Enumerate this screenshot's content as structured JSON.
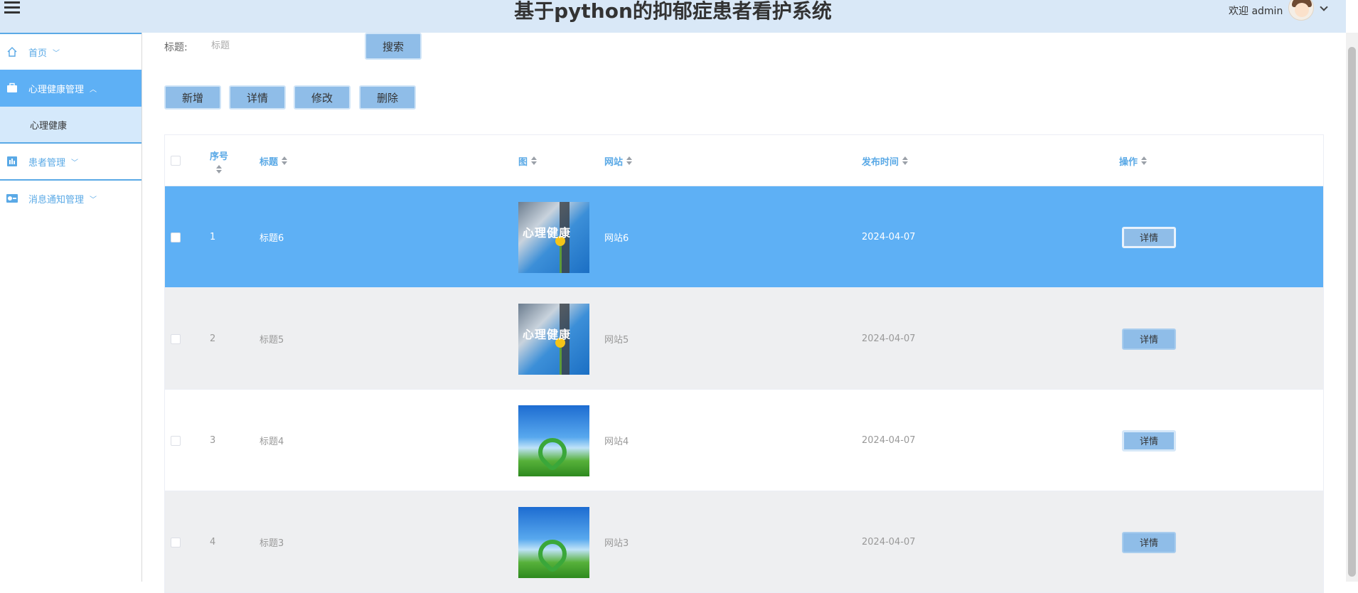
{
  "header": {
    "title": "基于python的抑郁症患者看护系统",
    "welcome": "欢迎 admin"
  },
  "sidebar": {
    "items": [
      {
        "label": "首页",
        "icon": "home-icon",
        "chevron": "﹀"
      },
      {
        "label": "心理健康管理",
        "icon": "briefcase-icon",
        "chevron": "︿",
        "active": true
      },
      {
        "label": "患者管理",
        "icon": "chart-icon",
        "chevron": "﹀"
      },
      {
        "label": "消息通知管理",
        "icon": "toggle-icon",
        "chevron": "﹀"
      }
    ],
    "sub_item": "心理健康"
  },
  "search": {
    "label": "标题:",
    "placeholder": "标题",
    "button": "搜索"
  },
  "toolbar": {
    "add": "新增",
    "detail": "详情",
    "edit": "修改",
    "delete": "删除"
  },
  "table": {
    "columns": {
      "index": "序号",
      "title": "标题",
      "image": "图",
      "website": "网站",
      "publish_time": "发布时间",
      "action": "操作"
    },
    "rows": [
      {
        "index": "1",
        "title": "标题6",
        "image": "心理健康",
        "website": "网站6",
        "publish_time": "2024-04-07",
        "action": "详情"
      },
      {
        "index": "2",
        "title": "标题5",
        "image": "心理健康",
        "website": "网站5",
        "publish_time": "2024-04-07",
        "action": "详情"
      },
      {
        "index": "3",
        "title": "标题4",
        "image": "",
        "website": "网站4",
        "publish_time": "2024-04-07",
        "action": "详情"
      },
      {
        "index": "4",
        "title": "标题3",
        "image": "",
        "website": "网站3",
        "publish_time": "2024-04-07",
        "action": "详情"
      }
    ]
  },
  "colors": {
    "header_bg": "#d9e8f7",
    "accent": "#5eb0f5",
    "button": "#8fbde8",
    "stripe": "#eeeff1"
  }
}
